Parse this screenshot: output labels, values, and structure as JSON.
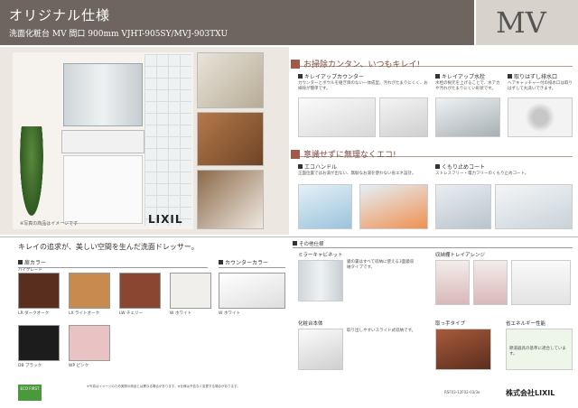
{
  "header": {
    "title": "オリジナル仕様",
    "subtitle": "洗面化粧台 MV 間口 900mm VJHT-905SY/MVJ-903TXU",
    "badge": "MV"
  },
  "hero": {
    "caption": "※写真の商品はイメージです",
    "brand": "LIXIL"
  },
  "features": {
    "section1_title": "お掃除カンタン、いつもキレイ!",
    "section2_title": "意識せずに無理なくエコ!",
    "items": [
      {
        "label": "キレイアップカウンター",
        "desc": "カウンターとボウルを継ぎ目のない一体成型。汚れがたまりにくく、お掃除が簡単です。",
        "img_label": "キレイアップカウンター"
      },
      {
        "label": "キレイアップ水栓",
        "desc": "水栓の根元を上げることで、水アカや汚れがたまりにくい形状です。",
        "img_label": "キレイアップ水栓"
      },
      {
        "label": "取りはずし排水口",
        "desc": "ヘアキャッチャー付の排水口は取りはずして丸洗いできます。",
        "img_label": ""
      },
      {
        "label": "エコハンドル",
        "desc": "正面位置ではお湯が出ない、無駄なお湯を使わない省エネ設計。",
        "img_label": "エコハンドル"
      },
      {
        "label": "くもり止めコート",
        "desc": "ストレスフリー・電力フリーのくもり止めコート。",
        "img_label": "くもり止めコート"
      }
    ]
  },
  "tagline": "キレイの追求が、美しい空間を生んだ洗面ドレッサー。",
  "colors": {
    "door_title": "扉カラー",
    "counter_title": "カウンターカラー",
    "high_gloss_label": "ハイグレード",
    "swatches": [
      {
        "code": "LR",
        "name": "ダークオーク",
        "color": "#5a2e1e"
      },
      {
        "code": "LX",
        "name": "ライトオーク",
        "color": "#c98a4e"
      },
      {
        "code": "LW",
        "name": "チェリー",
        "color": "#8a4630"
      },
      {
        "code": "W",
        "name": "ホワイト",
        "color": "#f0efec"
      },
      {
        "code": "DB",
        "name": "ブラック",
        "color": "#1c1c1c"
      },
      {
        "code": "WP",
        "name": "ピンク",
        "color": "#e9c2c4"
      }
    ],
    "counter": {
      "code": "W",
      "name": "ホワイト",
      "color": "#f4f4f4"
    }
  },
  "options": {
    "title": "その他仕様",
    "mirror_cabinet": "ミラーキャビネット",
    "mirror_desc": "鏡の裏はすべて収納に使える3面鏡収納タイプです。",
    "storage": "収納棚トレイアレンジ",
    "vanity": "化粧台本体",
    "vanity_desc": "取り出しやすいスライド式収納です。",
    "drawer": "取っ手タイプ",
    "eco_title": "省エネルギー性能",
    "eco_desc": "節湯器具の基準に適合しています。"
  },
  "footer": {
    "eco_badge": "ECO FIRST",
    "note": "※写真はイメージのため実際の商品とは異なる場合があります。※仕様は予告なく変更する場合があります。",
    "catalog_code": "RSF03-12F02-03/3e",
    "company": "株式会社LIXIL"
  },
  "accent_color": "#a05a4a"
}
